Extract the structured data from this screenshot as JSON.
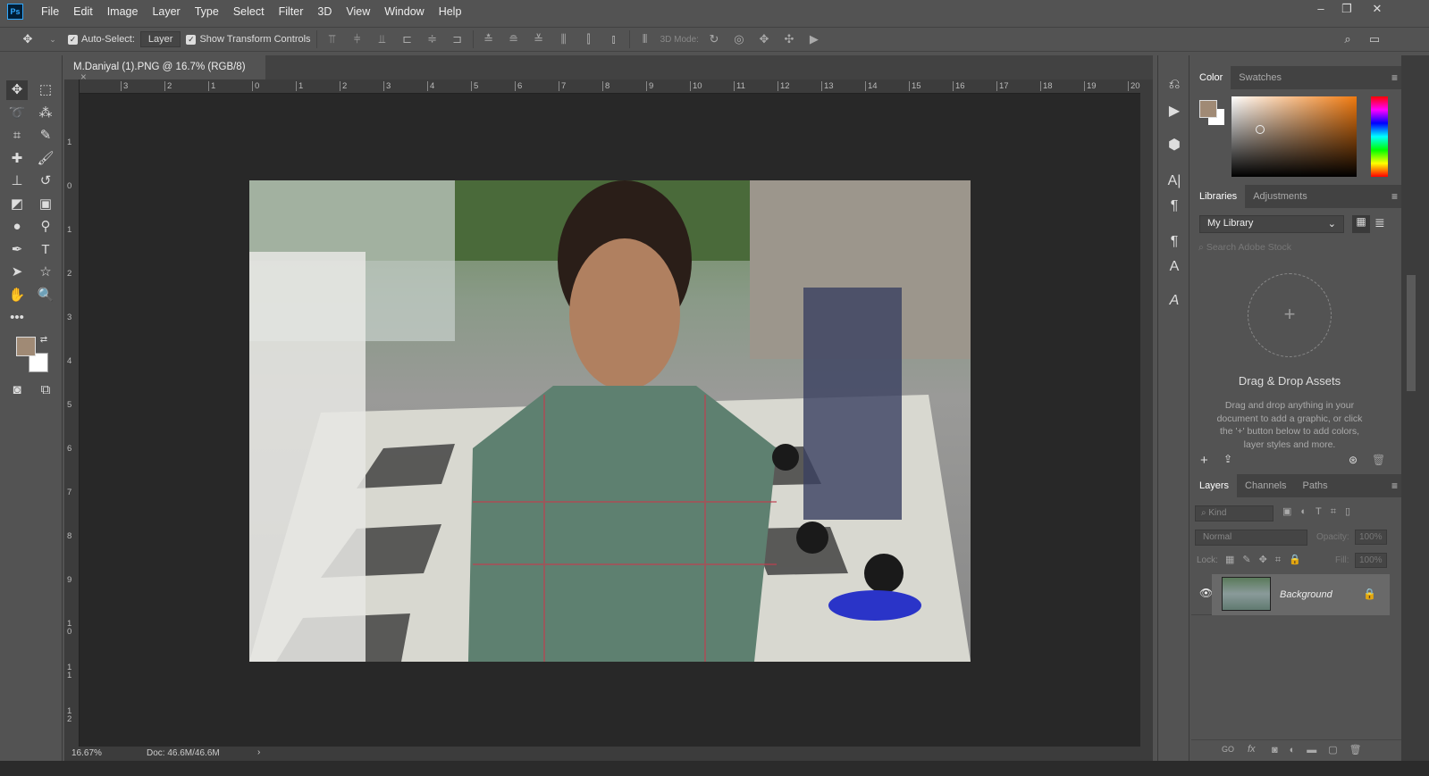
{
  "menubar": {
    "logo": "Ps",
    "items": [
      "File",
      "Edit",
      "Image",
      "Layer",
      "Type",
      "Select",
      "Filter",
      "3D",
      "View",
      "Window",
      "Help"
    ]
  },
  "options": {
    "auto_select_label": "Auto-Select:",
    "auto_select_target": "Layer",
    "show_transform_label": "Show Transform Controls",
    "mode_3d_label": "3D Mode:"
  },
  "document": {
    "tab_title": "M.Daniyal  (1).PNG @ 16.7% (RGB/8)",
    "close": "×"
  },
  "rulers": {
    "horizontal": [
      "3",
      "2",
      "1",
      "0",
      "1",
      "2",
      "3",
      "4",
      "5",
      "6",
      "7",
      "8",
      "9",
      "10",
      "11",
      "12",
      "13",
      "14",
      "15",
      "16",
      "17",
      "18",
      "19",
      "20"
    ],
    "vertical": [
      "1",
      "0",
      "1",
      "2",
      "3",
      "4",
      "5",
      "6",
      "7",
      "8",
      "9",
      "1 0",
      "1 1",
      "1 2"
    ]
  },
  "status": {
    "zoom": "16.67%",
    "doc": "Doc: 46.6M/46.6M",
    "arrow": "›"
  },
  "colors": {
    "foreground": "#a08a75",
    "background": "#ffffff",
    "accent": "#31a8ff"
  },
  "color_panel": {
    "tabs": [
      "Color",
      "Swatches"
    ]
  },
  "libraries_panel": {
    "tabs": [
      "Libraries",
      "Adjustments"
    ],
    "library": "My Library",
    "search_placeholder": "Search Adobe Stock",
    "empty_title": "Drag & Drop Assets",
    "empty_text": "Drag and drop anything in your document to add a graphic, or click the '+' button below to add colors, layer styles and more."
  },
  "layers_panel": {
    "tabs": [
      "Layers",
      "Channels",
      "Paths"
    ],
    "filter": "Kind",
    "blend_mode": "Normal",
    "opacity_label": "Opacity:",
    "opacity": "100%",
    "lock_label": "Lock:",
    "fill_label": "Fill:",
    "fill": "100%",
    "layers": [
      {
        "name": "Background",
        "visible": true,
        "locked": true
      }
    ],
    "footer_icons": [
      "GO",
      "fx"
    ]
  }
}
